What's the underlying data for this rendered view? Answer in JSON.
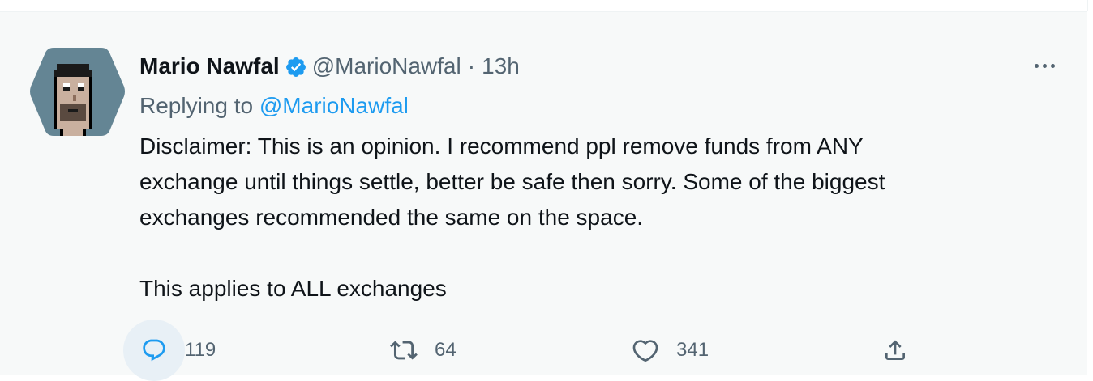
{
  "tweet": {
    "author": {
      "name": "Mario Nawfal",
      "handle": "@MarioNawfal",
      "verified": true,
      "avatar_icon": "pixel-avatar"
    },
    "separator": "·",
    "time": "13h",
    "replying_prefix": "Replying to",
    "replying_to": "@MarioNawfal",
    "body": [
      "Disclaimer: This is an opinion. I recommend ppl remove funds from ANY",
      "exchange until things settle, better be safe then sorry. Some of the biggest",
      "exchanges recommended the same on the space."
    ],
    "body_extra": "This applies to ALL exchanges",
    "actions": {
      "reply_count": "119",
      "retweet_count": "64",
      "like_count": "341"
    }
  },
  "colors": {
    "accent": "#1d9bf0",
    "text_primary": "#0f1419",
    "text_secondary": "#536471",
    "background": "#f7f9f9"
  }
}
